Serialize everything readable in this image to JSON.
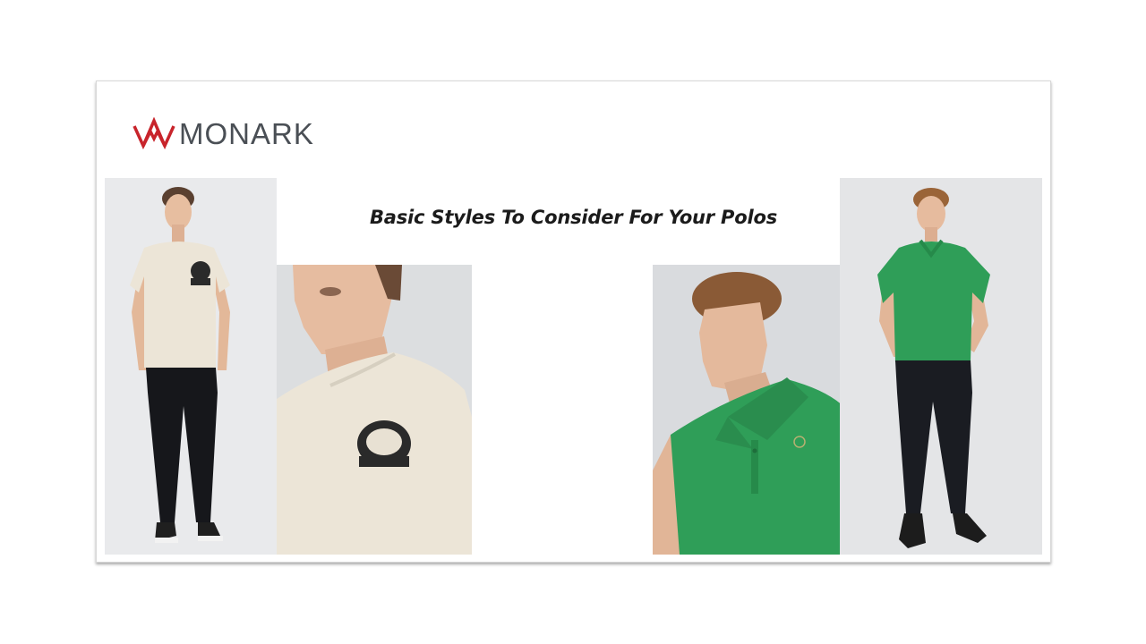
{
  "brand": {
    "logo_text": "MONARK",
    "logo_icon": "crown-icon",
    "logo_color": "#c8242b",
    "text_color": "#4a4f55"
  },
  "slide": {
    "headline": "Basic Styles To Consider For Your Polos"
  },
  "colors": {
    "tee": "#ece5d7",
    "polo": "#2f9e58",
    "jeans": "#1a1c22"
  },
  "images": [
    {
      "name": "model-in-cream-tee-full-body"
    },
    {
      "name": "cream-tee-chest-print-closeup"
    },
    {
      "name": "model-in-green-polo-closeup"
    },
    {
      "name": "model-in-green-polo-full-body"
    }
  ]
}
